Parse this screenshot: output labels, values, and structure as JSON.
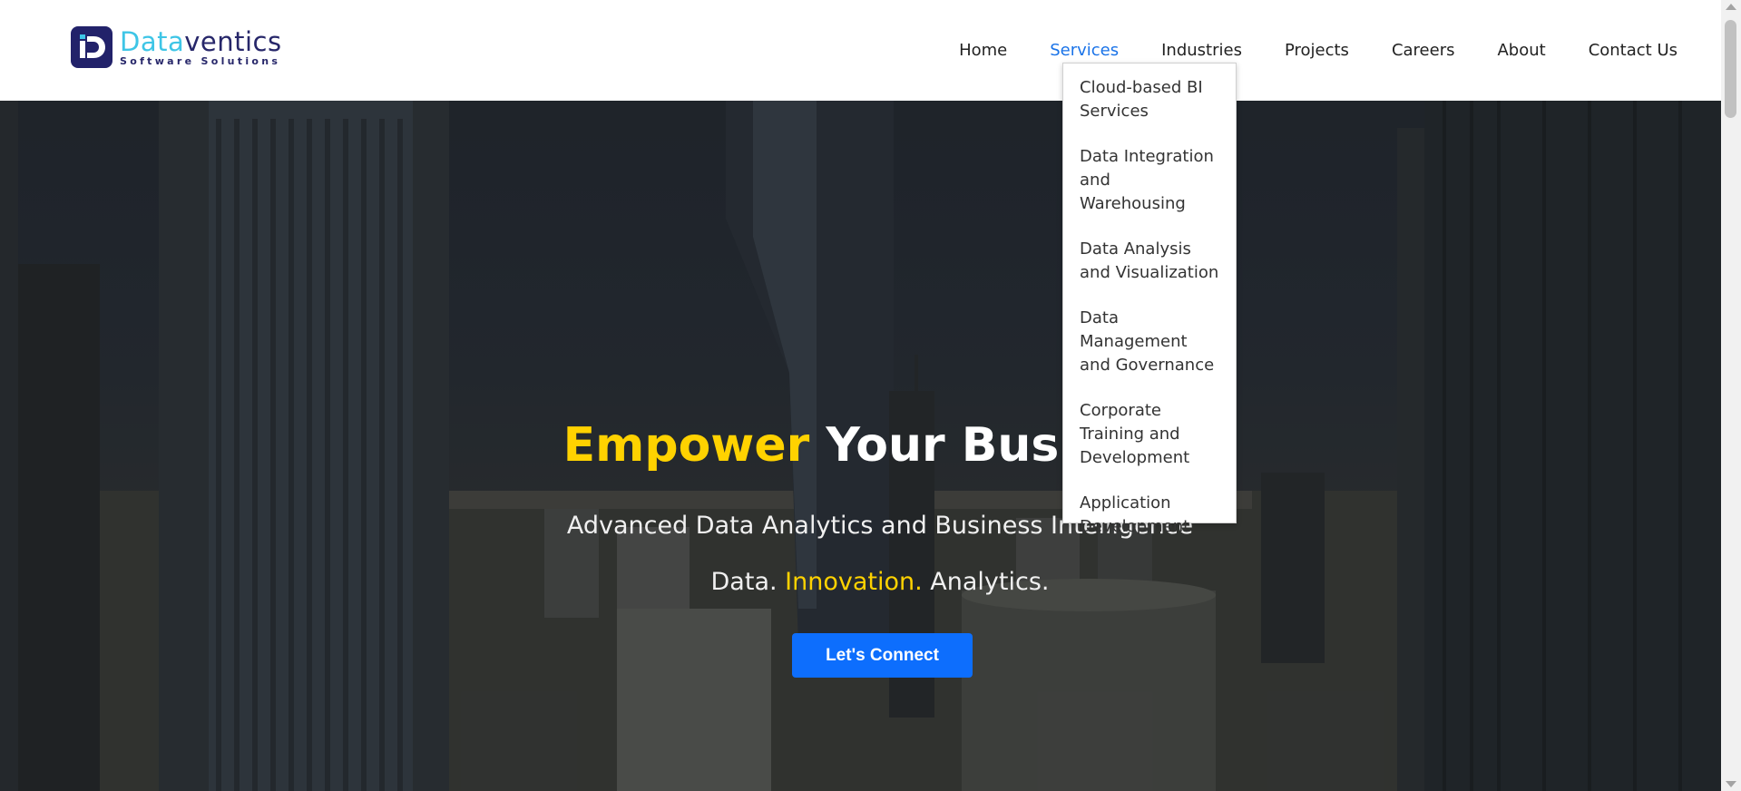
{
  "brand": {
    "name_part1": "Data",
    "name_part2": "ventics",
    "tagline": "Software Solutions"
  },
  "nav": {
    "items": [
      "Home",
      "Services",
      "Industries",
      "Projects",
      "Careers",
      "About",
      "Contact Us"
    ],
    "active": "Services"
  },
  "services_menu": {
    "items": [
      "Cloud-based BI Services",
      "Data Integration and Warehousing",
      "Data Analysis and Visualization",
      "Data Management and Governance",
      "Corporate Training and Development",
      "Application Development"
    ]
  },
  "hero": {
    "title_highlight": "Empower",
    "title_rest": " Your Business",
    "subtitle": "Advanced Data Analytics and Business Intelligence",
    "tagline_1": "Data. ",
    "tagline_2": "Innovation.",
    "tagline_3": " Analytics.",
    "cta": "Let's Connect"
  },
  "colors": {
    "accent": "#0d6efd",
    "highlight": "#ffd200",
    "logo_cyan": "#3ec5e6",
    "logo_navy": "#27276a"
  }
}
